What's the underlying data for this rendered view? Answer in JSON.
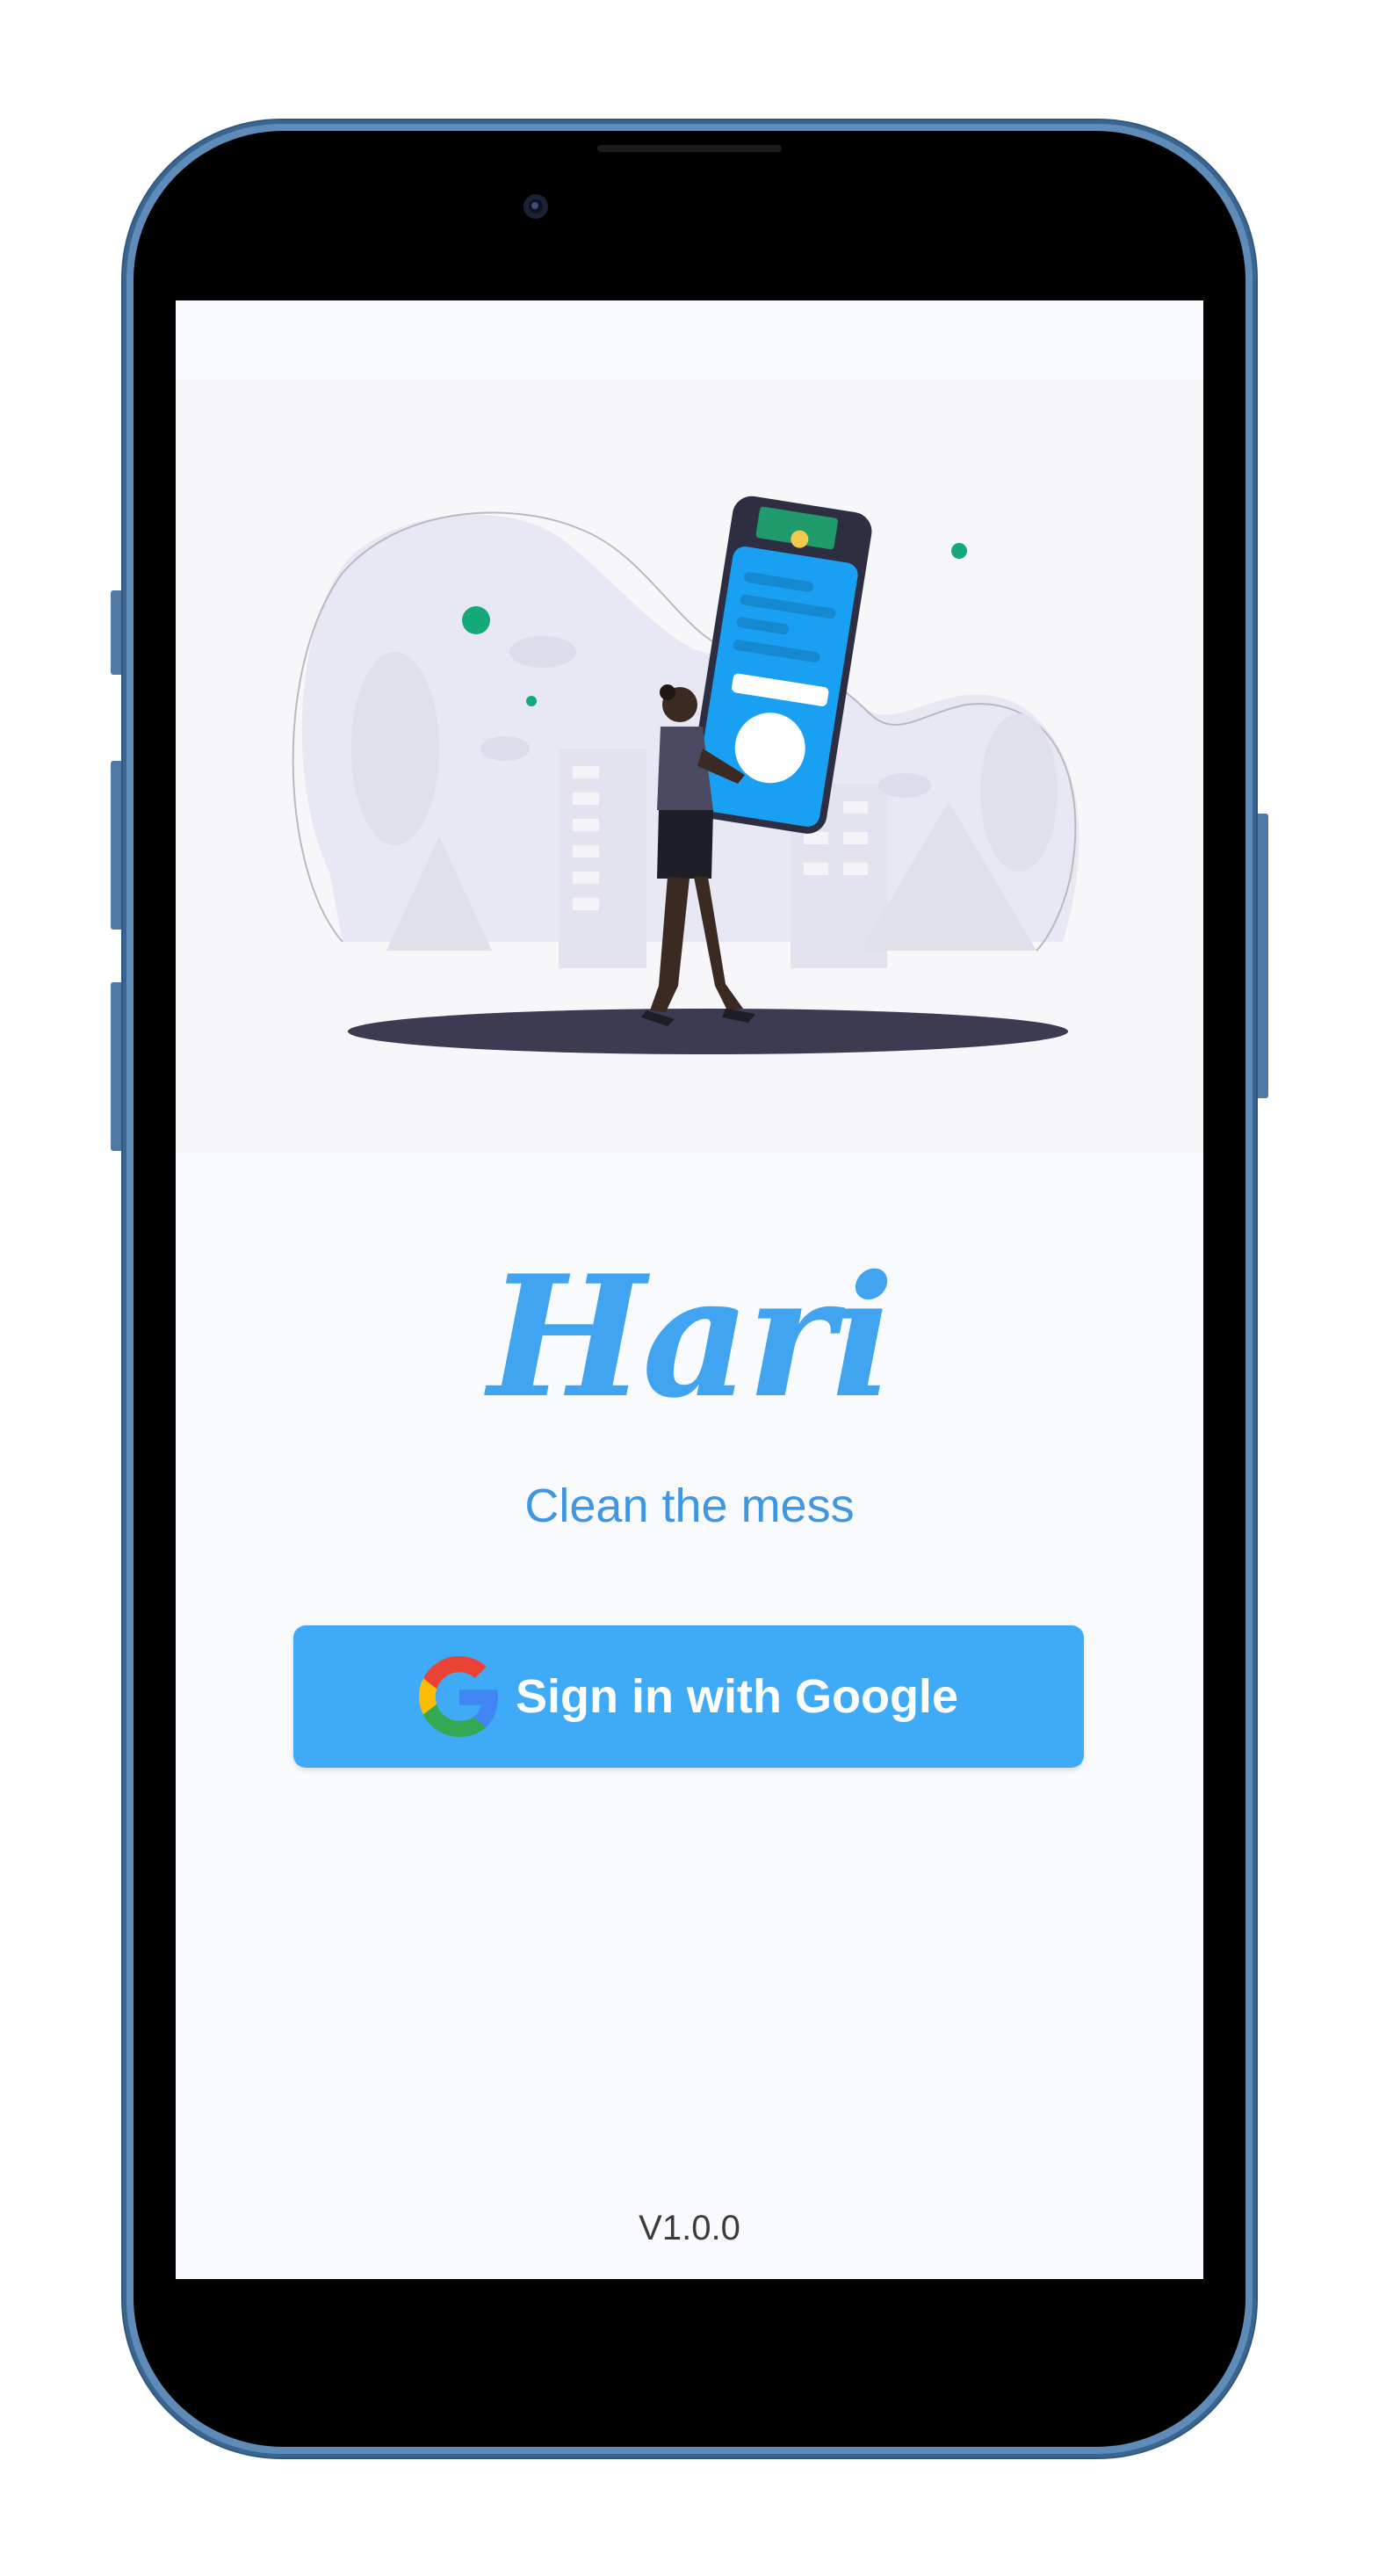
{
  "app": {
    "title": "Hari",
    "tagline": "Clean the mess",
    "version": "V1.0.0"
  },
  "signin": {
    "label": "Sign in with Google"
  },
  "icons": {
    "signin": "google-logo-icon"
  },
  "colors": {
    "accent": "#41a4f0",
    "button": "#3fabf6",
    "tagline": "#3f97e3",
    "screen_background": "#f9fafd",
    "device_frame": "#5f8bb8"
  }
}
